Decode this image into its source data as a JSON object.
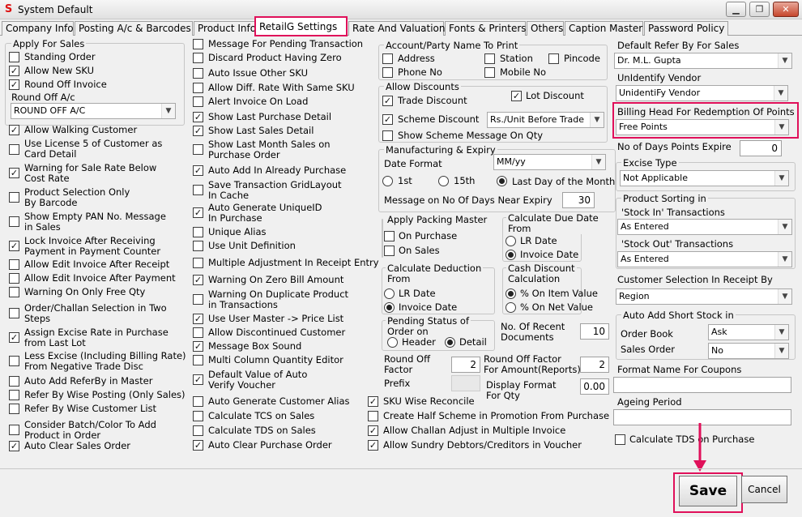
{
  "window": {
    "title": "System Default",
    "minimize": "▁",
    "restore": "❐",
    "close": "✕",
    "app_icon": "S"
  },
  "tabs": [
    "Company Info",
    "Posting A/c & Barcodes",
    "Product Info",
    "RetailG Settings",
    "Rate And Valuation",
    "Fonts & Printers",
    "Others",
    "Caption Master",
    "Password Policy"
  ],
  "col1": {
    "apply_for_sales": "Apply For Sales",
    "standing_order": "Standing Order",
    "allow_new_sku": "Allow New SKU",
    "round_off_invoice": "Round Off Invoice",
    "round_off_ac_label": "Round Off A/c",
    "round_off_ac_value": "ROUND OFF A/C",
    "allow_walking_customer": "Allow Walking Customer",
    "use_license5": "Use License 5 of Customer as\nCard Detail",
    "warning_sale_rate": "Warning for Sale Rate Below\nCost Rate",
    "product_selection_barcode": "Product Selection Only\nBy Barcode",
    "show_empty_pan": "Show Empty PAN No. Message\nin Sales",
    "lock_invoice": "Lock Invoice After Receiving\nPayment in Payment Counter",
    "allow_edit_receipt": "Allow Edit Invoice After Receipt",
    "allow_edit_payment": "Allow Edit Invoice After Payment",
    "warning_free_qty": "Warning On Only Free Qty",
    "order_challan_two_steps": "Order/Challan Selection in Two\nSteps",
    "assign_excise_rate": "Assign Excise Rate in Purchase\nfrom Last Lot",
    "less_excise": "Less Excise (Including Billing Rate)\nFrom Negative Trade Disc",
    "auto_add_referby": "Auto Add ReferBy in Master",
    "refer_by_wise_posting": "Refer By Wise Posting (Only Sales)",
    "refer_by_wise_customer": "Refer By Wise Customer List",
    "consider_batch_color": "Consider Batch/Color To Add\nProduct in Order",
    "auto_clear_sales_order": "Auto Clear Sales Order"
  },
  "col2": {
    "msg_pending_txn": "Message For Pending Transaction",
    "discard_product_zero": "Discard Product Having Zero",
    "auto_issue_sku": "Auto Issue Other SKU",
    "allow_diff_rate": "Allow Diff. Rate With Same SKU",
    "alert_invoice_load": "Alert Invoice On Load",
    "show_last_purchase": "Show Last Purchase Detail",
    "show_last_sales": "Show Last Sales Detail",
    "show_last_month_sales": "Show Last Month Sales on\nPurchase Order",
    "auto_add_purchase": "Auto Add In Already Purchase",
    "save_grid_layout": "Save Transaction GridLayout\nIn Cache",
    "auto_generate_uid": "Auto Generate UniqueID\nIn Purchase",
    "unique_alias": "Unique Alias",
    "use_unit_definition": "Use Unit Definition",
    "multiple_adjustment": "Multiple Adjustment In Receipt Entry",
    "warning_zero_bill": "Warning On Zero Bill Amount",
    "warning_duplicate": "Warning On Duplicate Product\nin Transactions",
    "use_user_master": "Use User Master -> Price List",
    "allow_discontinued": "Allow Discontinued Customer",
    "message_box_sound": "Message Box Sound",
    "multi_column_qty": "Multi Column Quantity Editor",
    "default_auto_verify": "Default Value of Auto\nVerify Voucher",
    "auto_gen_customer_alias": "Auto Generate Customer Alias",
    "calc_tcs_sales": "Calculate TCS on Sales",
    "calc_tds_sales": "Calculate TDS on Sales",
    "auto_clear_purchase_order": "Auto Clear Purchase Order"
  },
  "col3": {
    "account_party_name": "Account/Party Name To Print",
    "address": "Address",
    "station": "Station",
    "pincode": "Pincode",
    "phone_no": "Phone No",
    "mobile_no": "Mobile No",
    "allow_discounts": "Allow Discounts",
    "lot_discount": "Lot Discount",
    "trade_discount": "Trade Discount",
    "scheme_discount": "Scheme Discount",
    "scheme_discount_value": "Rs./Unit Before Trade",
    "show_scheme_msg": "Show Scheme Message On Qty",
    "mfg_expiry": "Manufacturing & Expiry",
    "date_format_label": "Date Format",
    "date_format_value": "MM/yy",
    "day_1st": "1st",
    "day_15th": "15th",
    "day_last": "Last  Day of the Month",
    "msg_near_expiry": "Message on  No Of Days Near Expiry",
    "near_expiry_days": "30",
    "apply_packing_master": "Apply Packing Master",
    "on_purchase": "On Purchase",
    "on_sales": "On Sales",
    "calc_due_date_from": "Calculate Due Date\nFrom",
    "lr_date": "LR Date",
    "invoice_date": "Invoice Date",
    "calc_deduction_from": "Calculate Deduction\nFrom",
    "cash_discount_calc": "Cash Discount\nCalculation",
    "on_item_value": "% On Item Value",
    "on_net_value": "% On Net Value",
    "pending_status": "Pending Status of\nOrder on",
    "header": "Header",
    "detail": "Detail",
    "no_recent_docs": "No. Of Recent\nDocuments",
    "no_recent_docs_value": "10",
    "round_off_factor": "Round Off\nFactor",
    "round_off_factor_value": "2",
    "round_off_amount": "Round Off Factor\nFor Amount(Reports)",
    "round_off_amount_value": "2",
    "prefix": "Prefix",
    "display_format_qty": "Display Format\nFor Qty",
    "display_format_value": "0.00",
    "sku_wise_reconcile": "SKU Wise Reconcile",
    "create_half_scheme": "Create Half Scheme in Promotion From Purchase",
    "allow_challan_adjust": "Allow Challan Adjust in Multiple Invoice",
    "allow_sundry": "Allow Sundry Debtors/Creditors in Voucher"
  },
  "col4": {
    "default_refer_by": "Default Refer By For Sales",
    "default_refer_by_value": "Dr. M.L. Gupta",
    "unidentify_vendor": "UnIdentify Vendor",
    "unidentify_vendor_value": "UnidentiFy Vendor",
    "billing_head": "Billing Head For Redemption Of Points",
    "billing_head_value": "Free Points",
    "days_points_expire": "No of Days Points Expire",
    "days_points_expire_value": "0",
    "excise_type": "Excise Type",
    "excise_type_value": "Not Applicable",
    "product_sorting": "Product Sorting in",
    "stock_in": "'Stock In' Transactions",
    "stock_in_value": "As Entered",
    "stock_out": "'Stock Out' Transactions",
    "stock_out_value": "As Entered",
    "customer_selection": "Customer Selection In Receipt By",
    "customer_selection_value": "Region",
    "auto_add_short_stock": "Auto Add Short Stock in",
    "order_book": "Order Book",
    "order_book_value": "Ask",
    "sales_order": "Sales Order",
    "sales_order_value": "No",
    "format_coupons": "Format Name For Coupons",
    "ageing_period": "Ageing Period",
    "calc_tds_purchase": "Calculate TDS on Purchase"
  },
  "buttons": {
    "save": "Save",
    "cancel": "Cancel"
  },
  "colors": {
    "highlight": "#e0105a",
    "background": "#f0f0f0"
  }
}
